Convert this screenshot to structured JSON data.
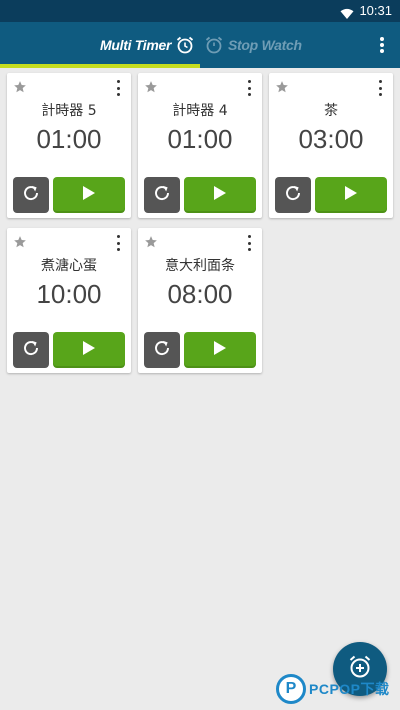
{
  "status_bar": {
    "time": "10:31",
    "wifi_icon": "wifi-icon"
  },
  "app_bar": {
    "tabs": [
      {
        "label": "Multi Timer",
        "icon": "alarm-clock-icon",
        "active": true
      },
      {
        "label": "Stop Watch",
        "icon": "stopwatch-icon",
        "active": false
      }
    ],
    "overflow_icon": "more-vert-icon"
  },
  "timers": [
    {
      "name": "計時器 5",
      "time": "01:00"
    },
    {
      "name": "計時器 4",
      "time": "01:00"
    },
    {
      "name": "茶",
      "time": "03:00"
    },
    {
      "name": "煮溏心蛋",
      "time": "10:00"
    },
    {
      "name": "意大利面条",
      "time": "08:00"
    }
  ],
  "card_icons": {
    "star": "star-icon",
    "menu": "more-vert-icon",
    "reset": "reset-icon",
    "play": "play-icon"
  },
  "fab": {
    "icon": "add-alarm-icon"
  },
  "watermark": {
    "logo": "P",
    "text": "PCPOP下载"
  },
  "colors": {
    "status_bar": "#0b3d5c",
    "app_bar": "#0f5b80",
    "tab_indicator": "#c5dd1f",
    "play_button": "#58a51a",
    "reset_button": "#555555",
    "background": "#ebebeb"
  }
}
